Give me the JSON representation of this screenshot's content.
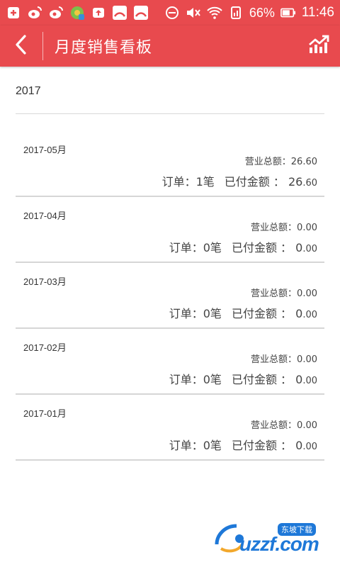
{
  "statusbar": {
    "battery_pct": "66%",
    "time": "11:46"
  },
  "appbar": {
    "title": "月度销售看板"
  },
  "year": "2017",
  "months": [
    {
      "month": "2017-05月",
      "revenue_label": "营业总额：",
      "revenue": "26.60",
      "orders_label": "订单：",
      "orders": "1笔",
      "paid_label": "已付金额 ：",
      "paid_int": "26",
      "paid_dec": ".60"
    },
    {
      "month": "2017-04月",
      "revenue_label": "营业总额：",
      "revenue": "0.00",
      "orders_label": "订单：",
      "orders": "0笔",
      "paid_label": "已付金额 ：",
      "paid_int": "0",
      "paid_dec": ".00"
    },
    {
      "month": "2017-03月",
      "revenue_label": "营业总额：",
      "revenue": "0.00",
      "orders_label": "订单：",
      "orders": "0笔",
      "paid_label": "已付金额 ：",
      "paid_int": "0",
      "paid_dec": ".00"
    },
    {
      "month": "2017-02月",
      "revenue_label": "营业总额：",
      "revenue": "0.00",
      "orders_label": "订单：",
      "orders": "0笔",
      "paid_label": "已付金额 ：",
      "paid_int": "0",
      "paid_dec": ".00"
    },
    {
      "month": "2017-01月",
      "revenue_label": "营业总额：",
      "revenue": "0.00",
      "orders_label": "订单：",
      "orders": "0笔",
      "paid_label": "已付金额 ：",
      "paid_int": "0",
      "paid_dec": ".00"
    }
  ],
  "watermark": {
    "text": "uzzf.com",
    "badge": "东坡下载"
  },
  "colors": {
    "brand": "#e84a4e",
    "divider": "#d6d6d6",
    "watermark": "#1e78d8"
  },
  "icons": {
    "back": "chevron-left-icon",
    "chart": "trend-chart-icon"
  }
}
